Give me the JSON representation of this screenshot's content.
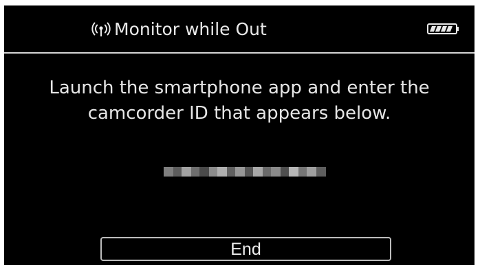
{
  "header": {
    "title": "Monitor while Out",
    "icons": {
      "wifi": "wifi-icon",
      "battery": "battery-icon"
    }
  },
  "main": {
    "message": "Launch the smartphone app and enter the camcorder ID that appears below.",
    "camcorder_id": {
      "redacted": true
    }
  },
  "actions": {
    "end_label": "End"
  },
  "colors": {
    "background": "#000000",
    "text": "#e6e6e6",
    "divider": "#d6d6d6",
    "button_border": "#bdbdbd"
  }
}
